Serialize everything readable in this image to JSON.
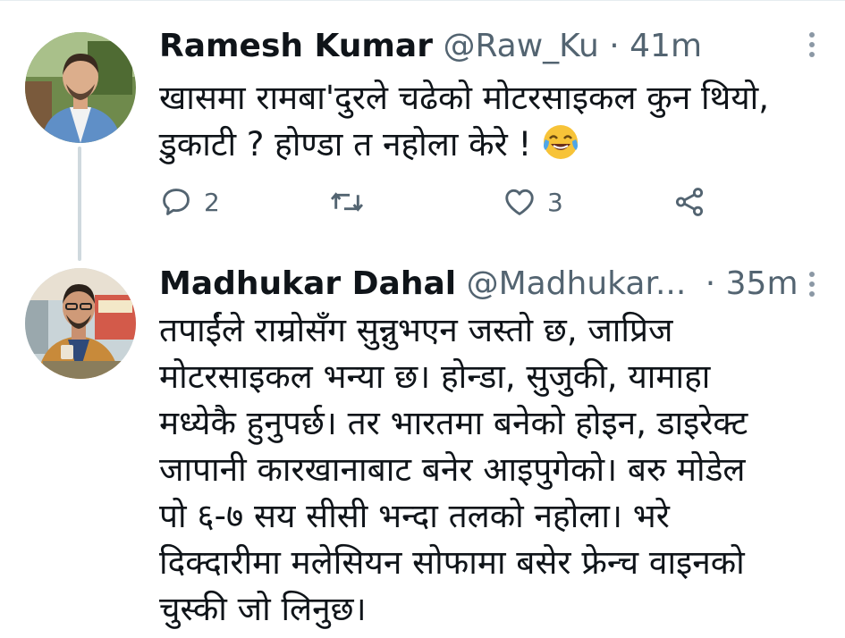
{
  "tweets": [
    {
      "name": "Ramesh Kumar",
      "handle": "@Raw_Ku",
      "separator": "·",
      "time": "41m",
      "text": "खासमा रामबा'दुरले चढेको मोटरसाइकल कुन थियो,\nडुकाटी ? होण्डा त नहोला केरे ! ",
      "emoji": "face-with-tears-of-joy",
      "reply_count": "2",
      "like_count": "3"
    },
    {
      "name": "Madhukar Dahal",
      "handle": "@Madhukar...",
      "separator": "·",
      "time": "35m",
      "text": "तपाईंले राम्रोसँग सुन्नुभएन जस्तो छ, जाप्रिज\nमोटरसाइकल भन्या छ। होन्डा, सुजुकी, यामाहा\nमध्येकै हुनुपर्छ। तर भारतमा बनेको होइन, डाइरेक्ट\nजापानी कारखानाबाट बनेर आइपुगेको। बरु मोडेल\nपो ६-७ सय सीसी भन्दा तलको नहोला। भरे\nदिक्दारीमा मलेसियन सोफामा बसेर फ्रेन्च वाइनको\nचुस्की जो लिनुछ।"
    }
  ],
  "icons": {
    "reply": "reply-icon",
    "retweet": "retweet-icon",
    "like": "like-icon",
    "share": "share-icon",
    "more": "more-vertical-icon"
  },
  "colors": {
    "text": "#0f1419",
    "secondary": "#536471",
    "thread_line": "#cfd9de"
  }
}
